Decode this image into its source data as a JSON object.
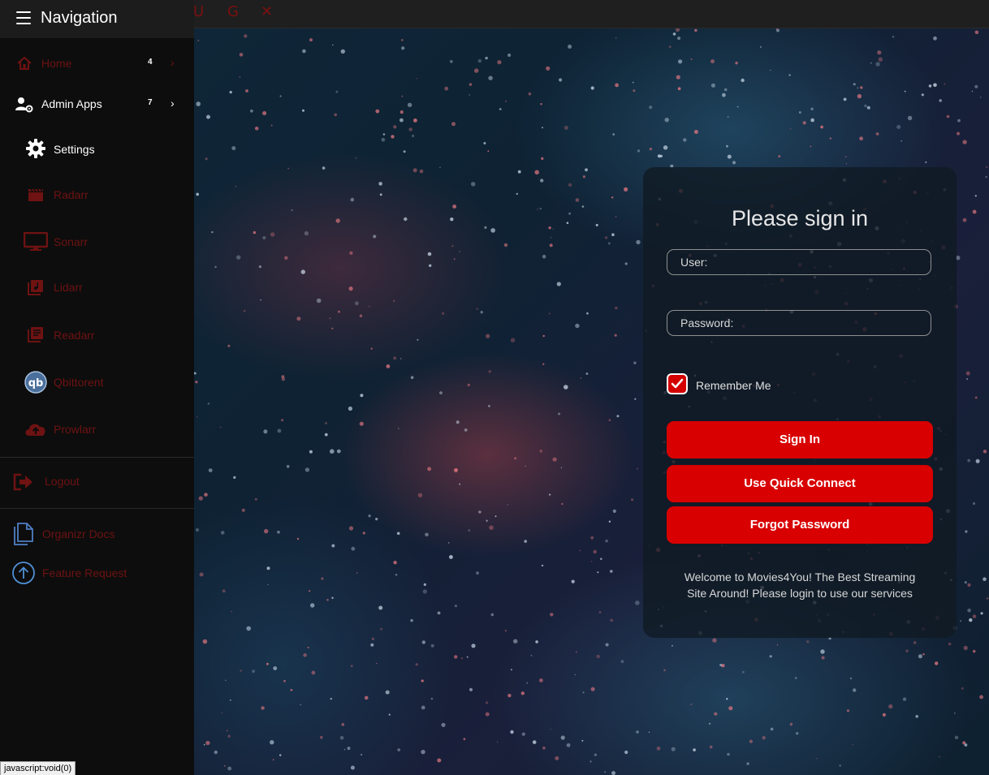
{
  "topbar": {
    "icons": [
      "user-icon",
      "refresh-icon",
      "close-icon"
    ],
    "icon_glyphs": [
      "U",
      "G",
      "✕"
    ]
  },
  "sidebar": {
    "title": "Navigation",
    "items": [
      {
        "label": "Home",
        "badge": "4",
        "icon": "home-icon",
        "color": "red"
      },
      {
        "label": "Admin Apps",
        "badge": "7",
        "icon": "user-gear-icon",
        "color": "white"
      },
      {
        "label": "Settings",
        "icon": "gear-icon",
        "color": "white"
      },
      {
        "label": "Radarr",
        "icon": "clapperboard-icon",
        "color": "red"
      },
      {
        "label": "Sonarr",
        "icon": "monitor-icon",
        "color": "red"
      },
      {
        "label": "Lidarr",
        "icon": "music-library-icon",
        "color": "red"
      },
      {
        "label": "Readarr",
        "icon": "book-library-icon",
        "color": "red"
      },
      {
        "label": "Qbittorent",
        "icon": "qbittorrent-icon",
        "color": "red"
      },
      {
        "label": "Prowlarr",
        "icon": "cloud-upload-icon",
        "color": "red"
      },
      {
        "label": "Logout",
        "icon": "logout-icon",
        "color": "red"
      },
      {
        "label": "Organizr Docs",
        "icon": "docs-icon",
        "color": "red"
      },
      {
        "label": "Feature Request",
        "icon": "arrow-up-circle-icon",
        "color": "red"
      }
    ]
  },
  "login": {
    "title": "Please sign in",
    "user_placeholder": "User:",
    "password_placeholder": "Password:",
    "remember_label": "Remember Me",
    "remember_checked": true,
    "sign_in_label": "Sign In",
    "quick_connect_label": "Use Quick Connect",
    "forgot_label": "Forgot Password",
    "welcome_text": "Welcome to Movies4You! The Best Streaming Site Around! Please login to use our services"
  },
  "statusbar": {
    "text": "javascript:void(0)"
  },
  "colors": {
    "accent": "#d80000",
    "sidebar_bg": "#0d0d0d",
    "dim_red": "#6e1212"
  }
}
